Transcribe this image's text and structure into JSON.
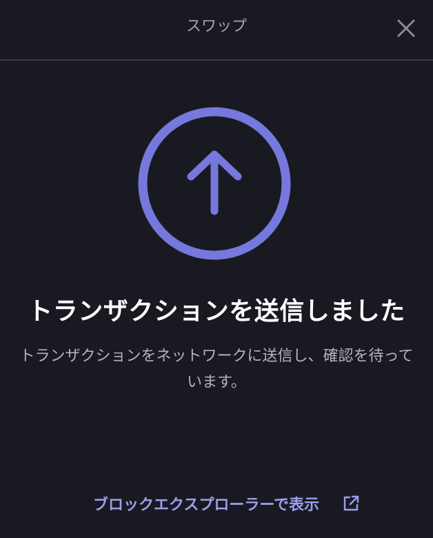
{
  "header": {
    "title": "スワップ"
  },
  "status": {
    "headline": "トランザクションを送信しました",
    "description": "トランザクションをネットワークに送信し、確認を待っています。"
  },
  "explorer_link": {
    "label": "ブロックエクスプローラーで表示"
  },
  "icons": {
    "close": "close-icon",
    "status": "arrow-up-circle-icon",
    "external": "external-link-icon"
  },
  "colors": {
    "background": "#191a21",
    "accent": "#7678dd",
    "link": "#9b9ff0",
    "divider": "#3a3b44"
  }
}
